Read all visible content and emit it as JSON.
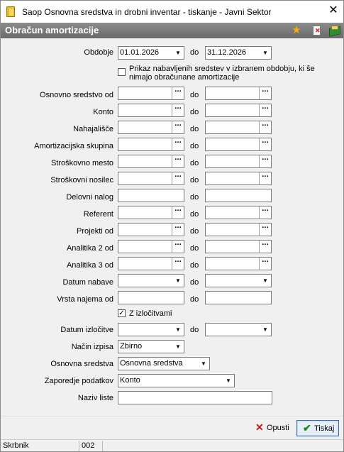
{
  "window": {
    "title": "Saop Osnovna sredstva in drobni inventar - tiskanje - Javni Sektor",
    "close_glyph": "✕"
  },
  "header": {
    "title": "Obračun amortizacije",
    "icons": [
      "star-icon",
      "document-delete-icon",
      "book-icon"
    ]
  },
  "form": {
    "sep_label": "do",
    "obdobje": {
      "label": "Obdobje",
      "from": "01.01.2026",
      "to": "31.12.2026"
    },
    "prikaz_checkbox": {
      "label_line1": "Prikaz nabavljenih sredstev v izbranem obdobju, ki še",
      "label_line2": "nimajo obračunane amortizacije",
      "checked": false
    },
    "rows": [
      {
        "label": "Osnovno sredstvo od",
        "kind": "picker"
      },
      {
        "label": "Konto",
        "kind": "picker"
      },
      {
        "label": "Nahajališče",
        "kind": "picker"
      },
      {
        "label": "Amortizacijska skupina",
        "kind": "picker"
      },
      {
        "label": "Stroškovno mesto",
        "kind": "picker"
      },
      {
        "label": "Stroškovni nosilec",
        "kind": "picker"
      },
      {
        "label": "Delovni nalog",
        "kind": "text"
      },
      {
        "label": "Referent",
        "kind": "picker"
      },
      {
        "label": "Projekti od",
        "kind": "picker"
      },
      {
        "label": "Analitika 2 od",
        "kind": "picker"
      },
      {
        "label": "Analitika 3 od",
        "kind": "picker"
      },
      {
        "label": "Datum nabave",
        "kind": "date"
      },
      {
        "label": "Vrsta najema od",
        "kind": "text"
      }
    ],
    "izlocitve_checkbox": {
      "label": "Z izločitvami",
      "checked": true
    },
    "datum_izlocitve": {
      "label": "Datum izločitve"
    },
    "nacin_izpisa": {
      "label": "Način izpisa",
      "value": "Zbirno"
    },
    "osnovna_sredstva": {
      "label": "Osnovna sredstva",
      "value": "Osnovna sredstva"
    },
    "zaporedje": {
      "label": "Zaporedje podatkov",
      "value": "Konto"
    },
    "naziv_liste": {
      "label": "Naziv liste",
      "value": ""
    }
  },
  "footer": {
    "cancel_label": "Opusti",
    "print_label": "Tiskaj"
  },
  "status": {
    "user": "Skrbnik",
    "code": "002"
  }
}
